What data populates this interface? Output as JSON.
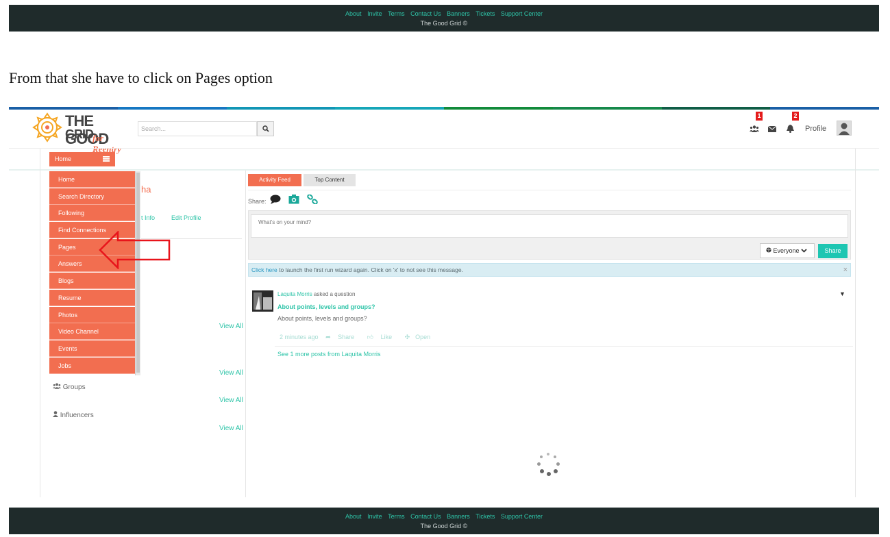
{
  "footer": {
    "links": [
      "About",
      "Invite",
      "Terms",
      "Contact Us",
      "Banners",
      "Tickets",
      "Support Center"
    ],
    "copyright": "The Good Grid ©"
  },
  "caption": "From that she have to click on Pages option",
  "header": {
    "logo": {
      "line1": "THE GOOD",
      "line2": "GRID",
      "tagline": "for Reentry"
    },
    "search_placeholder": "Search...",
    "friends_badge": "1",
    "notifications_badge": "2",
    "profile_label": "Profile"
  },
  "nav": {
    "home_label": "Home",
    "menu_items": [
      "Home",
      "Search Directory",
      "Following",
      "Find Connections",
      "Pages",
      "Answers",
      "Blogs",
      "Resume",
      "Photos",
      "Video Channel",
      "Events",
      "Jobs"
    ]
  },
  "sidebar": {
    "partial_name": "ha",
    "tab_contact_fragment": "t Info",
    "tab_edit_profile": "Edit Profile",
    "view_all": "View All",
    "groups_label": "Groups",
    "influencers_label": "Influencers"
  },
  "feed": {
    "tabs": [
      "Activity Feed",
      "Top Content"
    ],
    "share_label": "Share:",
    "composer_placeholder": "What's on your mind?",
    "audience": "Everyone",
    "share_button": "Share",
    "alert_link": "Click here",
    "alert_text": " to launch the first run wizard again. Click on 'x' to not see this message.",
    "alert_close": "×",
    "post": {
      "author": "Laquita Morris",
      "action": " asked a question",
      "title": "About points, levels and groups?",
      "body": "About points, levels and groups?",
      "time": "2 minutes ago",
      "share": "Share",
      "like": "Like",
      "open": "Open",
      "see_more": "See 1 more posts from Laquita Morris"
    }
  },
  "colors": {
    "accent": "#f26e50",
    "link": "#2ec4a8",
    "share_button": "#1ec6b2",
    "footer_bg": "#1f2b2b",
    "strip": [
      "#1a5fa6",
      "#1677c2",
      "#1196b5",
      "#15a6b8",
      "#118b3a",
      "#16894a",
      "#0f5d46",
      "#1a5fa6"
    ]
  }
}
